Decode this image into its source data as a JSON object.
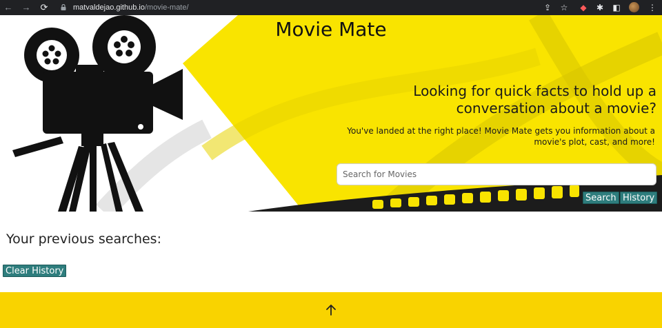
{
  "browser": {
    "url_host": "matvaldejao.github.io",
    "url_path": "/movie-mate/",
    "icons": [
      "back-icon",
      "forward-icon",
      "reload-icon",
      "lock-icon",
      "share-icon",
      "star-icon",
      "extension-icon",
      "puzzle-icon",
      "sidepanel-icon",
      "profile-avatar",
      "menu-icon"
    ]
  },
  "hero": {
    "title": "Movie Mate",
    "tagline": "Looking for quick facts to hold up a conversation about a movie?",
    "description": "You've landed at the right place! Movie Mate gets you information about a movie's plot, cast, and more!",
    "search": {
      "placeholder": "Search for Movies",
      "value": ""
    },
    "search_button": "Search",
    "history_button": "History"
  },
  "history": {
    "heading": "Your previous searches:",
    "clear_button": "Clear History"
  },
  "footer": {
    "scroll_icon": "arrow-up-icon"
  },
  "colors": {
    "yellow": "#f9e400",
    "footer_yellow": "#f9d300",
    "button_teal": "#2e7d7d",
    "chrome": "#202124"
  }
}
